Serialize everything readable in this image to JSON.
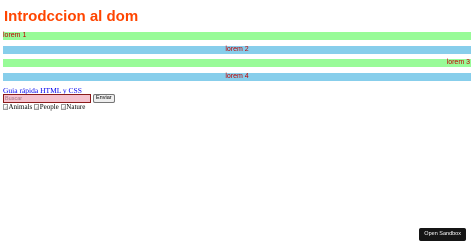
{
  "page": {
    "title": "Introdccion al dom"
  },
  "bars": [
    {
      "label": "lorem 1",
      "color": "#98fb98",
      "align": "left"
    },
    {
      "label": "lorem 2",
      "color": "#87ceeb",
      "align": "center"
    },
    {
      "label": "lorem 3",
      "color": "#98fb98",
      "align": "right"
    },
    {
      "label": "lorem 4",
      "color": "#87ceeb",
      "align": "center"
    }
  ],
  "link": {
    "label": "Guia rápida HTML y CSS"
  },
  "form": {
    "search_placeholder": "Buscar",
    "search_value": "",
    "send_label": "Enviar"
  },
  "images": [
    {
      "alt": "Animals"
    },
    {
      "alt": "People"
    },
    {
      "alt": "Nature"
    }
  ],
  "sandbox": {
    "label": "Open Sandbox"
  },
  "colors": {
    "title": "#ff4500",
    "bar_text": "#c00000",
    "input_bg": "#f4c2cf",
    "input_border": "#8b1a1a",
    "sandbox_bg": "#151515"
  }
}
